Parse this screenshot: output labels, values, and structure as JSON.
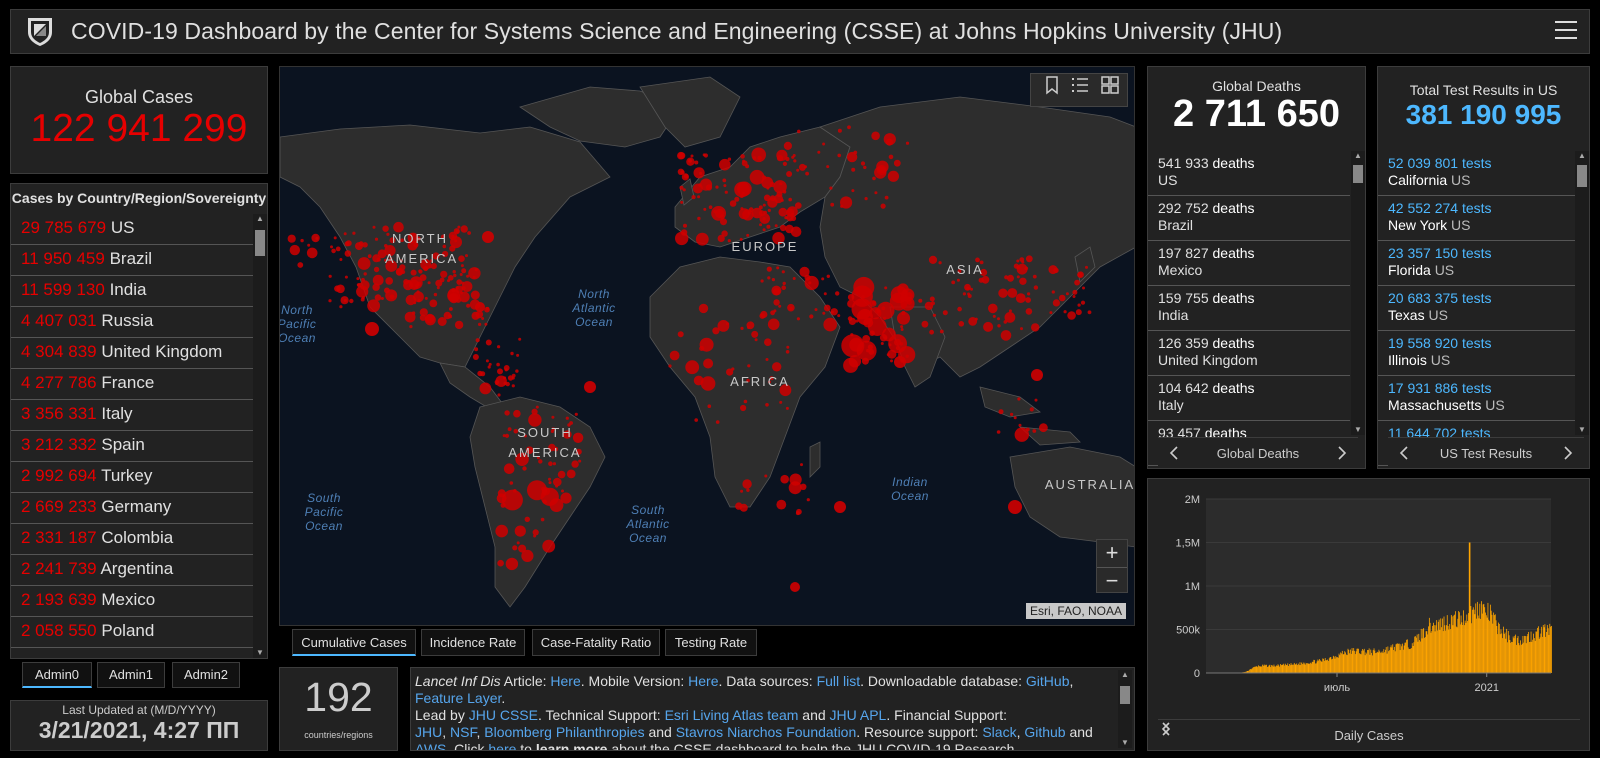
{
  "header": {
    "title": "COVID-19 Dashboard by the Center for Systems Science and Engineering (CSSE) at Johns Hopkins University (JHU)",
    "logo_icon": "jhu-shield-icon",
    "menu_icon": "hamburger-menu-icon"
  },
  "colors": {
    "accent_red": "#e60000",
    "accent_blue": "#4db8ff",
    "chart_bar": "#ffa500",
    "link": "#56a5ec",
    "panel_bg": "#222222",
    "bg": "#000000"
  },
  "global_cases": {
    "label": "Global Cases",
    "value": "122 941 299"
  },
  "country_list": {
    "header": "Cases by Country/Region/Sovereignty",
    "items": [
      {
        "value": "29 785 679",
        "name": "US"
      },
      {
        "value": "11 950 459",
        "name": "Brazil"
      },
      {
        "value": "11 599 130",
        "name": "India"
      },
      {
        "value": "4 407 031",
        "name": "Russia"
      },
      {
        "value": "4 304 839",
        "name": "United Kingdom"
      },
      {
        "value": "4 277 786",
        "name": "France"
      },
      {
        "value": "3 356 331",
        "name": "Italy"
      },
      {
        "value": "3 212 332",
        "name": "Spain"
      },
      {
        "value": "2 992 694",
        "name": "Turkey"
      },
      {
        "value": "2 669 233",
        "name": "Germany"
      },
      {
        "value": "2 331 187",
        "name": "Colombia"
      },
      {
        "value": "2 241 739",
        "name": "Argentina"
      },
      {
        "value": "2 193 639",
        "name": "Mexico"
      },
      {
        "value": "2 058 550",
        "name": "Poland"
      }
    ]
  },
  "admin_tabs": [
    "Admin0",
    "Admin1",
    "Admin2"
  ],
  "last_updated": {
    "label": "Last Updated at (M/D/YYYY)",
    "value": "3/21/2021, 4:27 ПП"
  },
  "map": {
    "tools": [
      "bookmark-icon",
      "legend-list-icon",
      "basemap-gallery-icon"
    ],
    "zoom_in": "+",
    "zoom_out": "−",
    "attribution": "Esri, FAO, NOAA",
    "continents": [
      "NORTH AMERICA",
      "EUROPE",
      "ASIA",
      "AFRICA",
      "SOUTH AMERICA",
      "AUSTRALIA"
    ],
    "oceans": [
      "North Pacific Ocean",
      "North Atlantic Ocean",
      "South Pacific Ocean",
      "South Atlantic Ocean",
      "Indian Ocean"
    ]
  },
  "map_tabs": [
    "Cumulative Cases",
    "Incidence Rate",
    "Case-Fatality Ratio",
    "Testing Rate"
  ],
  "countries_count": {
    "value": "192",
    "label": "countries/regions"
  },
  "info": {
    "journal": "Lancet Inf Dis",
    "t1": " Article: ",
    "here1": "Here",
    "t2": ". Mobile Version: ",
    "here2": "Here",
    "t3": ". Data sources: ",
    "full_list": "Full list",
    "t4": ". Downloadable database: ",
    "github": "GitHub",
    "t5": ", ",
    "feature_layer": "Feature Layer",
    "t6": ".",
    "t7": "Lead by ",
    "jhu_csse": "JHU CSSE",
    "t8": ". Technical Support: ",
    "esri": "Esri Living Atlas team",
    "t9": " and ",
    "jhu_apl": "JHU APL",
    "t10": ". Financial Support:",
    "jhu": "JHU",
    "t11": ", ",
    "nsf": "NSF",
    "t12": ", ",
    "bloomberg": "Bloomberg Philanthropies",
    "t13": " and ",
    "stavros": "Stavros Niarchos Foundation",
    "t14": ". Resource support: ",
    "slack": "Slack",
    "t15": ", ",
    "github2": "Github",
    "t16": " and",
    "aws": "AWS",
    "t17": ". Click ",
    "here3": "here",
    "t18": " to ",
    "learn_more": "learn more",
    "t19": " about the CSSE dashboard to help the JHU COVID-19 Research"
  },
  "global_deaths": {
    "label": "Global Deaths",
    "value": "2 711 650",
    "unit": "deaths",
    "items": [
      {
        "value": "541 933",
        "name": "US"
      },
      {
        "value": "292 752",
        "name": "Brazil"
      },
      {
        "value": "197 827",
        "name": "Mexico"
      },
      {
        "value": "159 755",
        "name": "India"
      },
      {
        "value": "126 359",
        "name": "United Kingdom"
      },
      {
        "value": "104 642",
        "name": "Italy"
      },
      {
        "value": "93 457",
        "name": ""
      }
    ],
    "pager_label": "Global Deaths"
  },
  "test_results": {
    "label": "Total Test Results in US",
    "value": "381 190 995",
    "unit": "tests",
    "items": [
      {
        "value": "52 039 801",
        "state": "California",
        "country": "US"
      },
      {
        "value": "42 552 274",
        "state": "New York",
        "country": "US"
      },
      {
        "value": "23 357 150",
        "state": "Florida",
        "country": "US"
      },
      {
        "value": "20 683 375",
        "state": "Texas",
        "country": "US"
      },
      {
        "value": "19 558 920",
        "state": "Illinois",
        "country": "US"
      },
      {
        "value": "17 931 886",
        "state": "Massachusetts",
        "country": "US"
      },
      {
        "value": "11 644 702",
        "state": "",
        "country": ""
      }
    ],
    "pager_label": "US Test Results"
  },
  "chart_data": {
    "type": "bar",
    "title": "",
    "xlabel": "",
    "ylabel": "",
    "ylim": [
      0,
      2000000
    ],
    "yticks": [
      "0",
      "500k",
      "1M",
      "1,5M",
      "2M"
    ],
    "ytick_values": [
      0,
      500000,
      1000000,
      1500000,
      2000000
    ],
    "xticks": [
      "июль",
      "2021"
    ],
    "x_start": "2020-01-22",
    "x_end": "2021-03-21",
    "xtick_dates": [
      "2020-07-01",
      "2021-01-01"
    ],
    "series": [
      {
        "values_weekly": [
          500,
          2000,
          3000,
          2500,
          2000,
          2000,
          3000,
          15000,
          55000,
          80000,
          85000,
          85000,
          85000,
          90000,
          95000,
          100000,
          105000,
          115000,
          125000,
          135000,
          140000,
          160000,
          185000,
          210000,
          235000,
          250000,
          260000,
          255000,
          255000,
          245000,
          250000,
          265000,
          280000,
          300000,
          315000,
          330000,
          350000,
          400000,
          470000,
          550000,
          560000,
          575000,
          600000,
          620000,
          630000,
          650000,
          680000,
          720000,
          780000,
          720000,
          680000,
          560000,
          480000,
          430000,
          400000,
          390000,
          410000,
          440000,
          470000,
          500000
        ]
      }
    ],
    "spike": {
      "date": "2020-12-10",
      "value": 1500000
    },
    "pager_label": "Daily Cases"
  }
}
